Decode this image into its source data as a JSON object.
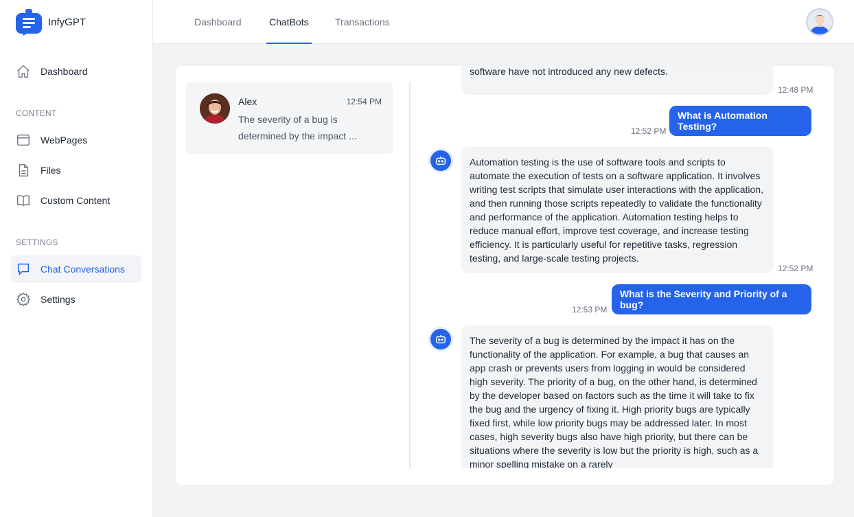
{
  "app": {
    "name": "InfyGPT"
  },
  "sidebar": {
    "items": [
      {
        "label": "Dashboard",
        "icon": "home-icon"
      },
      {
        "label": "WebPages",
        "icon": "browser-window-icon"
      },
      {
        "label": "Files",
        "icon": "file-icon"
      },
      {
        "label": "Custom Content",
        "icon": "book-icon"
      },
      {
        "label": "Chat Conversations",
        "icon": "chat-bubble-icon",
        "active": true
      },
      {
        "label": "Settings",
        "icon": "gear-icon"
      }
    ],
    "sections": {
      "content": "CONTENT",
      "settings": "SETTINGS"
    }
  },
  "topbar": {
    "tabs": [
      {
        "label": "Dashboard"
      },
      {
        "label": "ChatBots",
        "active": true
      },
      {
        "label": "Transactions"
      }
    ]
  },
  "conversations": [
    {
      "name": "Alex",
      "time": "12:54 PM",
      "preview": "The severity of a bug is determined by the impact ..."
    }
  ],
  "messages": {
    "partial_bot": {
      "text": "software have not introduced any new defects.",
      "time": "12:48 PM"
    },
    "user1": {
      "text": "What is Automation Testing?",
      "time": "12:52 PM"
    },
    "bot1": {
      "text": "Automation testing is the use of software tools and scripts to automate the execution of tests on a software application. It involves writing test scripts that simulate user interactions with the application, and then running those scripts repeatedly to validate the functionality and performance of the application. Automation testing helps to reduce manual effort, improve test coverage, and increase testing efficiency. It is particularly useful for repetitive tasks, regression testing, and large-scale testing projects.",
      "time": "12:52 PM"
    },
    "user2": {
      "text": "What is the Severity and Priority of a bug?",
      "time": "12:53 PM"
    },
    "bot2": {
      "text": "The severity of a bug is determined by the impact it has on the functionality of the application. For example, a bug that causes an app crash or prevents users from logging in would be considered high severity. The priority of a bug, on the other hand, is determined by the developer based on factors such as the time it will take to fix the bug and the urgency of fixing it. High priority bugs are typically fixed first, while low priority bugs may be addressed later. In most cases, high severity bugs also have high priority, but there can be situations where the severity is low but the priority is high, such as a minor spelling mistake on a rarely"
    }
  },
  "colors": {
    "accent": "#2563eb",
    "bubble_bot": "#f3f4f6",
    "page_bg": "#f1f2f4"
  }
}
